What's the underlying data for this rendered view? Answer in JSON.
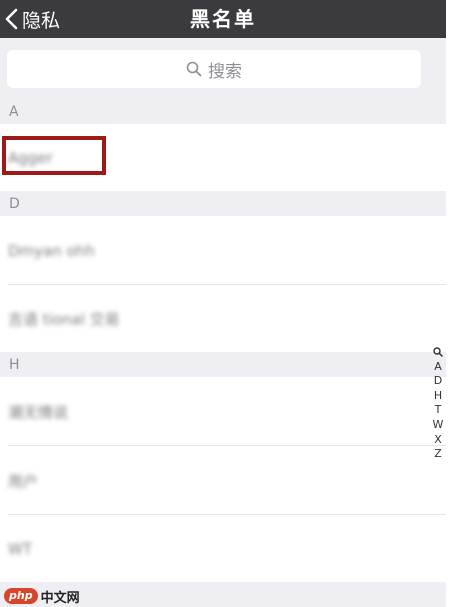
{
  "nav": {
    "back_label": "隐私",
    "title": "黑名单"
  },
  "search": {
    "placeholder": "搜索"
  },
  "sections": [
    {
      "letter": "A",
      "names": [
        "Agger"
      ]
    },
    {
      "letter": "D",
      "names": [
        "Dmyan ohh"
      ]
    },
    {
      "letter": "",
      "names": [
        "吉语 tional 交易"
      ]
    },
    {
      "letter": "H",
      "names": [
        "潮无情说"
      ]
    },
    {
      "letter": "",
      "names": [
        "用户"
      ]
    },
    {
      "letter": "",
      "names": [
        "WT"
      ]
    }
  ],
  "index_bar": {
    "items": [
      "A",
      "D",
      "H",
      "T",
      "W",
      "X",
      "Z"
    ]
  },
  "watermark": {
    "logo": "php",
    "text": "中文网"
  }
}
